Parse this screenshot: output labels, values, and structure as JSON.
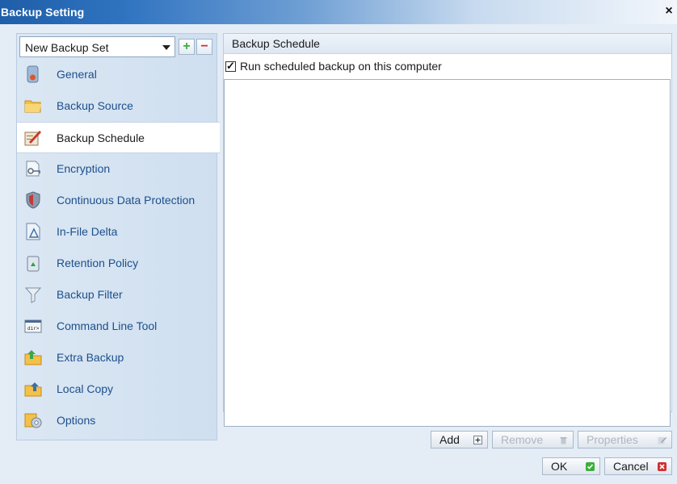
{
  "window": {
    "title": "Backup Setting",
    "close_glyph": "×"
  },
  "sidebar": {
    "backup_set": "New Backup Set",
    "add_glyph": "+",
    "remove_glyph": "−",
    "items": [
      {
        "label": "General",
        "icon": "general-icon"
      },
      {
        "label": "Backup Source",
        "icon": "folder-icon"
      },
      {
        "label": "Backup Schedule",
        "icon": "schedule-icon",
        "active": true
      },
      {
        "label": "Encryption",
        "icon": "encryption-key-icon"
      },
      {
        "label": "Continuous Data Protection",
        "icon": "shield-icon"
      },
      {
        "label": "In-File Delta",
        "icon": "document-delta-icon"
      },
      {
        "label": "Retention Policy",
        "icon": "recycle-bin-icon"
      },
      {
        "label": "Backup Filter",
        "icon": "funnel-icon"
      },
      {
        "label": "Command Line Tool",
        "icon": "command-line-icon"
      },
      {
        "label": "Extra Backup",
        "icon": "extra-backup-icon"
      },
      {
        "label": "Local Copy",
        "icon": "local-copy-icon"
      },
      {
        "label": "Options",
        "icon": "options-gear-icon"
      }
    ]
  },
  "main": {
    "header": "Backup Schedule",
    "run_scheduled_label": "Run scheduled backup on this computer",
    "run_scheduled_checked": true,
    "schedules": []
  },
  "buttons": {
    "add": "Add",
    "remove": "Remove",
    "properties": "Properties",
    "ok": "OK",
    "cancel": "Cancel"
  },
  "colors": {
    "accent": "#1d4f8b",
    "ok_green": "#3cae3c",
    "cancel_red": "#d03030"
  }
}
